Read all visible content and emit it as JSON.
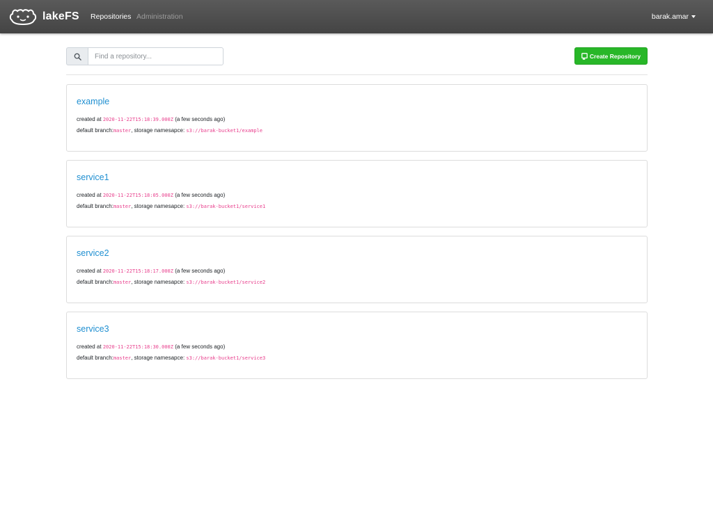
{
  "navbar": {
    "brand": "lakeFS",
    "links": [
      {
        "label": "Repositories",
        "active": true
      },
      {
        "label": "Administration",
        "active": false
      }
    ],
    "user": "barak.amar"
  },
  "toolbar": {
    "search_placeholder": "Find a repository...",
    "create_label": "Create Repository"
  },
  "labels": {
    "created_at": "created at",
    "default_branch": "default branch:",
    "storage_namespace": ", storage namesapce:"
  },
  "repositories": [
    {
      "name": "example",
      "created": "2020-11-22T15:18:39.000Z",
      "relative": "(a few seconds ago)",
      "branch": "master",
      "namespace": "s3://barak-bucket1/example"
    },
    {
      "name": "service1",
      "created": "2020-11-22T15:18:05.000Z",
      "relative": "(a few seconds ago)",
      "branch": "master",
      "namespace": "s3://barak-bucket1/service1"
    },
    {
      "name": "service2",
      "created": "2020-11-22T15:18:17.000Z",
      "relative": "(a few seconds ago)",
      "branch": "master",
      "namespace": "s3://barak-bucket1/service2"
    },
    {
      "name": "service3",
      "created": "2020-11-22T15:18:30.000Z",
      "relative": "(a few seconds ago)",
      "branch": "master",
      "namespace": "s3://barak-bucket1/service3"
    }
  ],
  "colors": {
    "navbar": "#4d4d4d",
    "link": "#1f8fd1",
    "create_button": "#28b728",
    "code": "#e83e8c"
  },
  "icons": {
    "logo": "lakefs-axolotl-logo",
    "search": "search-icon",
    "create": "repository-icon",
    "user_caret": "caret-down-icon"
  }
}
